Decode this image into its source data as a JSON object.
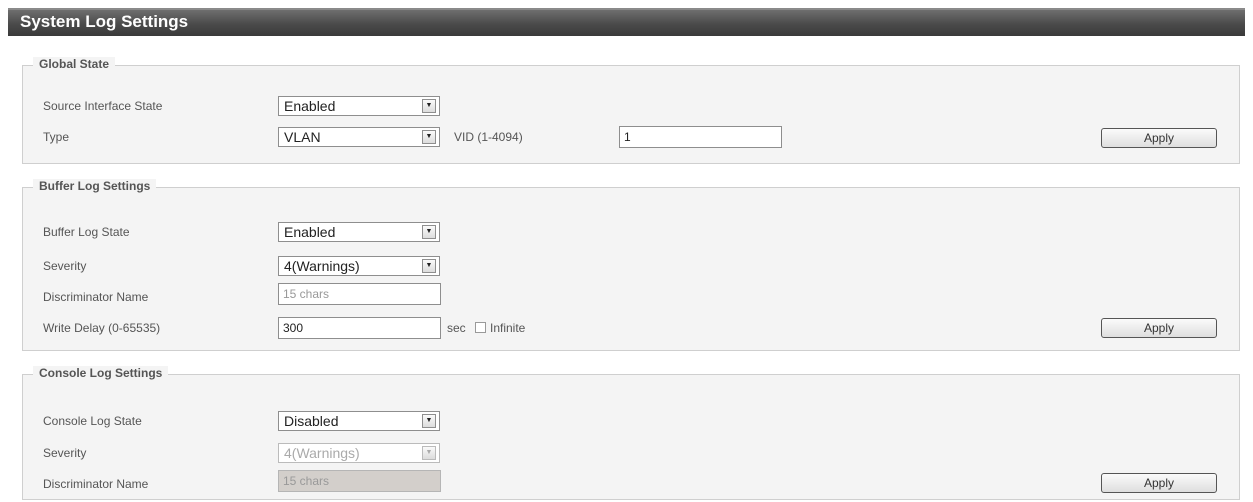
{
  "page": {
    "title": "System Log Settings"
  },
  "global_state": {
    "legend": "Global State",
    "source_interface_state": {
      "label": "Source Interface State",
      "value": "Enabled"
    },
    "type": {
      "label": "Type",
      "value": "VLAN"
    },
    "vid": {
      "label": "VID (1-4094)",
      "value": "1"
    },
    "apply_label": "Apply"
  },
  "buffer_log": {
    "legend": "Buffer Log Settings",
    "state": {
      "label": "Buffer Log State",
      "value": "Enabled"
    },
    "severity": {
      "label": "Severity",
      "value": "4(Warnings)"
    },
    "discriminator": {
      "label": "Discriminator Name",
      "placeholder": "15 chars"
    },
    "write_delay": {
      "label": "Write Delay (0-65535)",
      "value": "300",
      "unit": "sec",
      "infinite_label": "Infinite",
      "infinite_checked": false
    },
    "apply_label": "Apply"
  },
  "console_log": {
    "legend": "Console Log Settings",
    "state": {
      "label": "Console Log State",
      "value": "Disabled"
    },
    "severity": {
      "label": "Severity",
      "value": "4(Warnings)"
    },
    "discriminator": {
      "label": "Discriminator Name",
      "placeholder": "15 chars"
    },
    "apply_label": "Apply"
  }
}
